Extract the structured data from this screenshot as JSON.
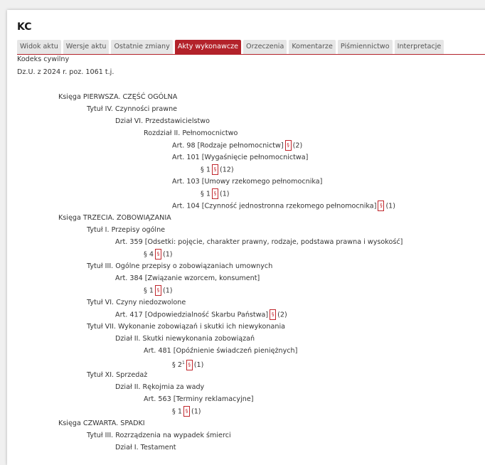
{
  "document": {
    "code": "KC",
    "name": "Kodeks cywilny",
    "journal": "Dz.U. z 2024 r. poz. 1061 t.j."
  },
  "tabs": [
    {
      "label": "Widok aktu",
      "active": false
    },
    {
      "label": "Wersje aktu",
      "active": false
    },
    {
      "label": "Ostatnie zmiany",
      "active": false
    },
    {
      "label": "Akty wykonawcze",
      "active": true
    },
    {
      "label": "Orzeczenia",
      "active": false
    },
    {
      "label": "Komentarze",
      "active": false
    },
    {
      "label": "Piśmiennictwo",
      "active": false
    },
    {
      "label": "Interpretacje",
      "active": false
    }
  ],
  "colors": {
    "accent": "#b3222a",
    "tab_bg": "#e6e6e6"
  },
  "tree": [
    {
      "level": 0,
      "text": "Księga PIERWSZA. CZĘŚĆ OGÓLNA"
    },
    {
      "level": 1,
      "text": "Tytuł IV. Czynności prawne"
    },
    {
      "level": 2,
      "text": "Dział VI. Przedstawicielstwo"
    },
    {
      "level": 3,
      "text": "Rozdział II. Pełnomocnictwo"
    },
    {
      "level": 4,
      "text": "Art. 98 [Rodzaje pełnomocnictw]",
      "count": "(2)"
    },
    {
      "level": 4,
      "text": "Art. 101 [Wygaśnięcie pełnomocnictwa]"
    },
    {
      "level": 5,
      "text": "§ 1",
      "count": "(12)"
    },
    {
      "level": 4,
      "text": "Art. 103 [Umowy rzekomego pełnomocnika]"
    },
    {
      "level": 5,
      "text": "§ 1",
      "count": "(1)"
    },
    {
      "level": 4,
      "text": "Art. 104 [Czynność jednostronna rzekomego pełnomocnika]",
      "count": "(1)"
    },
    {
      "level": 0,
      "text": "Księga TRZECIA. ZOBOWIĄZANIA"
    },
    {
      "level": 1,
      "text": "Tytuł I. Przepisy ogólne"
    },
    {
      "level": 2,
      "text": "Art. 359 [Odsetki: pojęcie, charakter prawny, rodzaje, podstawa prawna i wysokość]"
    },
    {
      "level": 3,
      "text": "§ 4",
      "count": "(1)"
    },
    {
      "level": 1,
      "text": "Tytuł III. Ogólne przepisy o zobowiązaniach umownych"
    },
    {
      "level": 2,
      "text": "Art. 384 [Związanie wzorcem, konsument]"
    },
    {
      "level": 3,
      "text": "§ 1",
      "count": "(1)"
    },
    {
      "level": 1,
      "text": "Tytuł VI. Czyny niedozwolone"
    },
    {
      "level": 2,
      "text": "Art. 417 [Odpowiedzialność Skarbu Państwa]",
      "count": "(2)"
    },
    {
      "level": 1,
      "text": "Tytuł VII. Wykonanie zobowiązań i skutki ich niewykonania"
    },
    {
      "level": 2,
      "text": "Dział II. Skutki niewykonania zobowiązań"
    },
    {
      "level": 3,
      "text": "Art. 481 [Opóźnienie świadczeń pieniężnych]"
    },
    {
      "level": 4,
      "text": "§ 2",
      "sup": "1",
      "count": "(1)"
    },
    {
      "level": 1,
      "text": "Tytuł XI. Sprzedaż"
    },
    {
      "level": 2,
      "text": "Dział II. Rękojmia za wady"
    },
    {
      "level": 3,
      "text": "Art. 563 [Terminy reklamacyjne]"
    },
    {
      "level": 4,
      "text": "§ 1",
      "count": "(1)"
    },
    {
      "level": 0,
      "text": "Księga CZWARTA. SPADKI"
    },
    {
      "level": 1,
      "text": "Tytuł III. Rozrządzenia na wypadek śmierci"
    },
    {
      "level": 2,
      "text": "Dział I. Testament"
    }
  ],
  "icons": {
    "paragraph": "paragraph-link-icon",
    "paragraph_glyph": "§"
  }
}
